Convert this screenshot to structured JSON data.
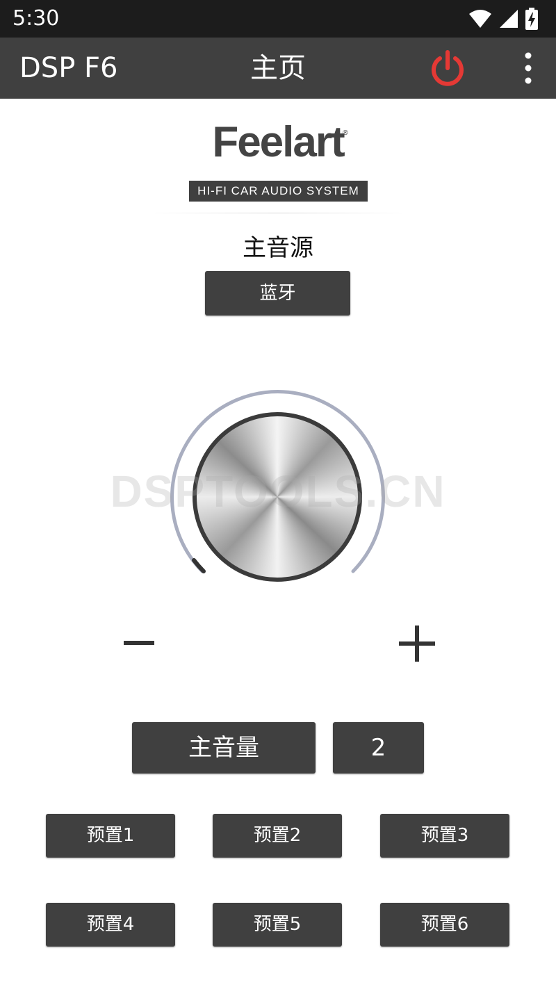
{
  "status_bar": {
    "time": "5:30",
    "icons": [
      "wifi-icon",
      "cell-signal-icon",
      "battery-charging-icon"
    ]
  },
  "app_bar": {
    "app_name": "DSP F6",
    "page_title": "主页",
    "power_color": "#e53935",
    "icons": [
      "power-icon",
      "more-vert-icon"
    ]
  },
  "logo": {
    "wordmark": "Feelart",
    "registered": "®",
    "tagline": "HI-FI CAR AUDIO SYSTEM"
  },
  "source": {
    "label": "主音源",
    "value": "蓝牙"
  },
  "watermark": "DSPTOOLS.CN",
  "volume": {
    "label": "主音量",
    "value": "2",
    "minus": "−",
    "plus": "+"
  },
  "presets": [
    "预置1",
    "预置2",
    "预置3",
    "预置4",
    "预置5",
    "预置6"
  ],
  "colors": {
    "button": "#404040",
    "app_bar": "#404040",
    "status_bar": "#1c1c1c",
    "knob_ring": "#a9aec0"
  }
}
